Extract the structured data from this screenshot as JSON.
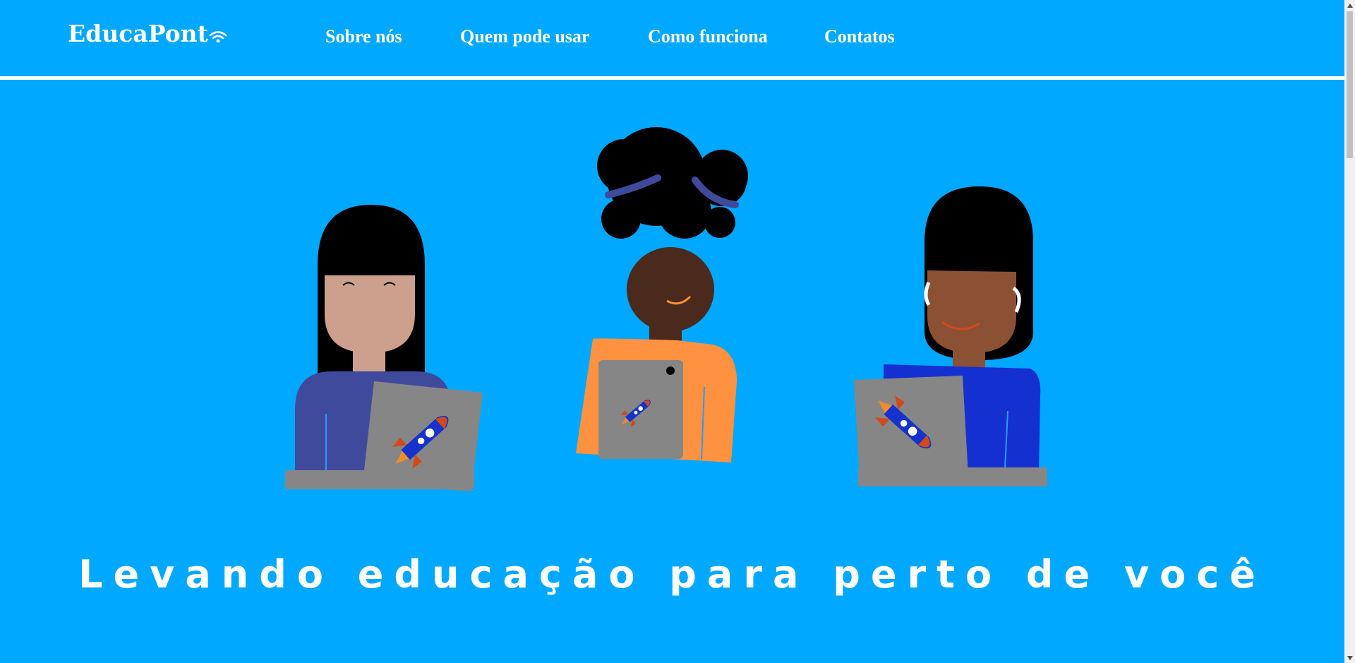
{
  "brand": {
    "name": "EducaPont",
    "icon": "wifi-icon"
  },
  "nav": {
    "items": [
      {
        "label": "Sobre nós"
      },
      {
        "label": "Quem pode usar"
      },
      {
        "label": "Como funciona"
      },
      {
        "label": "Contatos"
      }
    ]
  },
  "hero": {
    "headline": "Levando educação para perto de você",
    "illustration": "three-students-with-laptops-and-tablet"
  },
  "colors": {
    "background": "#00a8ff",
    "text": "#ffffff",
    "device_gray": "#868686",
    "rocket_blue": "#1533cc",
    "rocket_orange": "#d14a1a"
  }
}
